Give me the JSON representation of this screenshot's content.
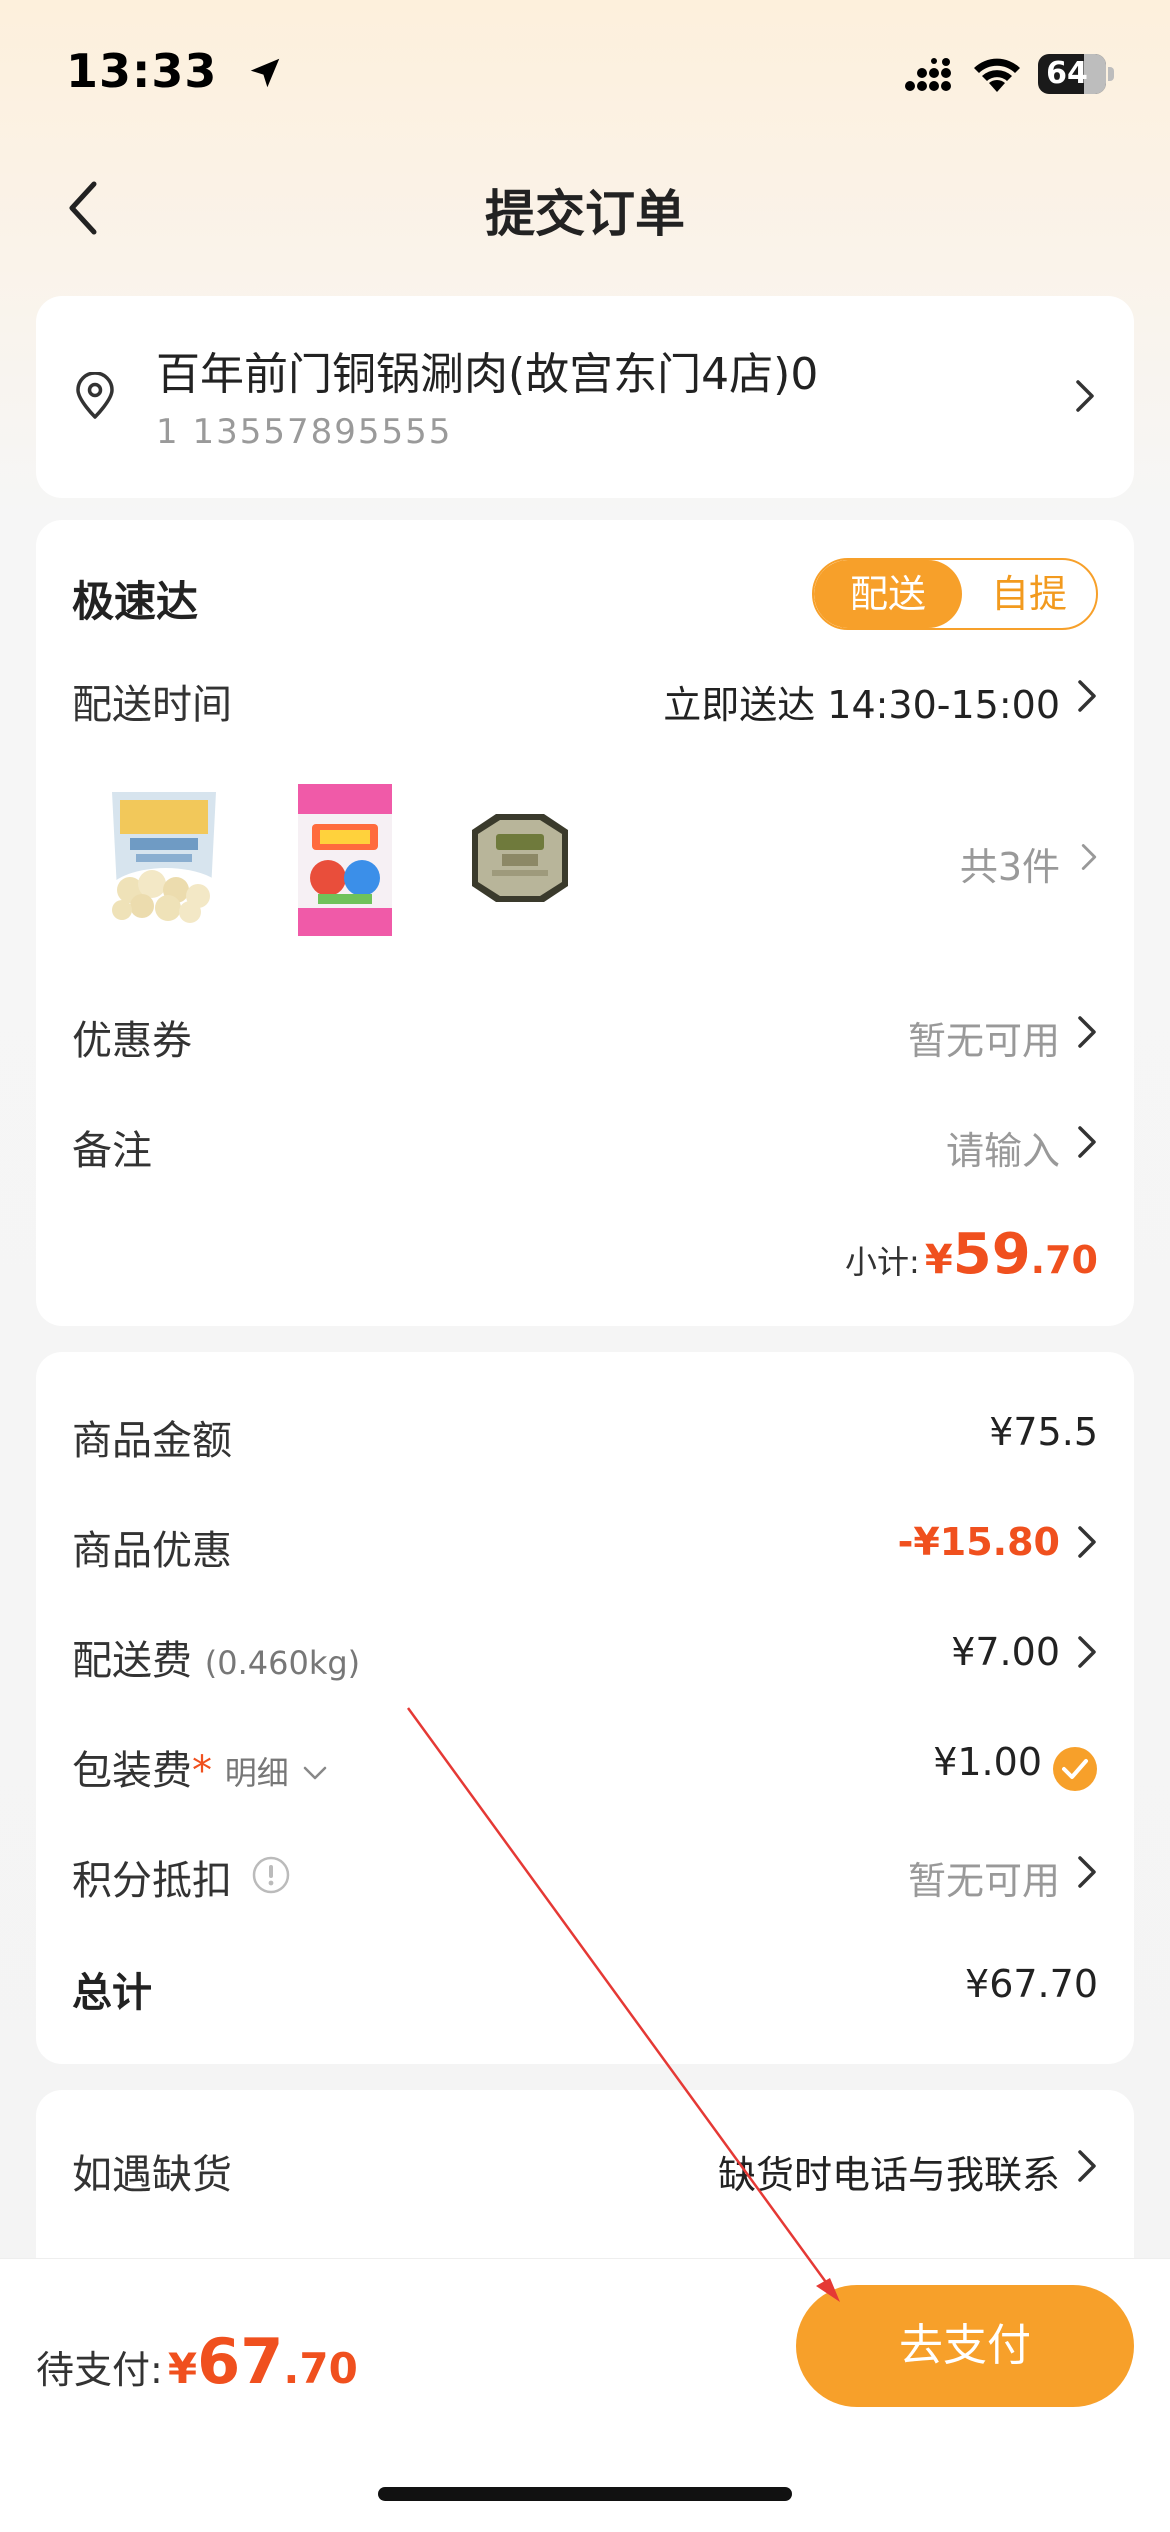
{
  "status_bar": {
    "time": "13:33",
    "battery": "64"
  },
  "nav": {
    "title": "提交订单",
    "back_icon": "chevron-left-icon"
  },
  "address": {
    "name": "百年前门铜锅涮肉(故宫东门4店)0",
    "contact": "1  13557895555",
    "icon": "location-pin-icon"
  },
  "order": {
    "shop_name": "极速达",
    "delivery_modes": [
      "配送",
      "自提"
    ],
    "selected_mode": "配送",
    "delivery_time_label": "配送时间",
    "delivery_time_value": "立即送达 14:30-15:00",
    "item_count": "共3件",
    "coupon_label": "优惠券",
    "coupon_value": "暂无可用",
    "note_label": "备注",
    "note_placeholder": "请输入",
    "subtotal_label": "小计:",
    "subtotal_symbol": "¥",
    "subtotal_int": "59",
    "subtotal_dec": ".70"
  },
  "fees": {
    "goods_amount_label": "商品金额",
    "goods_amount": "¥75.5",
    "goods_discount_label": "商品优惠",
    "goods_discount": "-¥15.80",
    "delivery_fee_label": "配送费",
    "delivery_weight": "(0.460kg)",
    "delivery_fee": "¥7.00",
    "packaging_label": "包装费",
    "packaging_star": "*",
    "packaging_detail": "明细",
    "packaging_fee": "¥1.00",
    "points_label": "积分抵扣",
    "points_value": "暂无可用",
    "total_label": "总计",
    "total": "¥67.70"
  },
  "stock": {
    "label": "如遇缺货",
    "value": "缺货时电话与我联系"
  },
  "bottom": {
    "pay_label": "待支付:",
    "pay_symbol": "¥",
    "pay_int": "67",
    "pay_dec": ".70",
    "pay_button": "去支付"
  },
  "colors": {
    "accent": "#f7a02a",
    "price_red": "#f0501e",
    "annotation_arrow": "#e53935"
  }
}
